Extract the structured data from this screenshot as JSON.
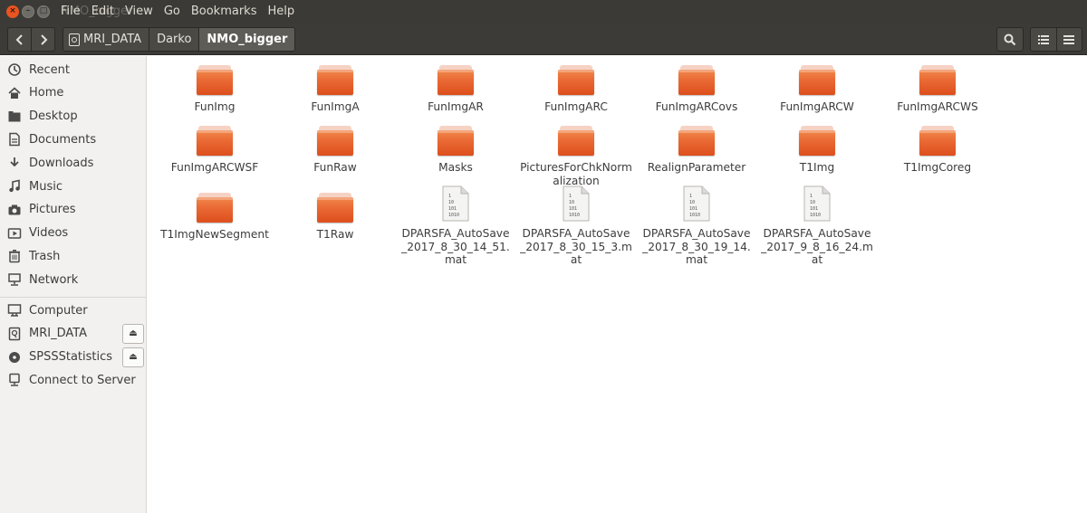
{
  "window": {
    "title_ghost": "NMO_bigger",
    "close_glyph": "×",
    "min_glyph": "–",
    "max_glyph": "□"
  },
  "menu": [
    "File",
    "Edit",
    "View",
    "Go",
    "Bookmarks",
    "Help"
  ],
  "toolbar": {
    "back_icon": "chevron-left-icon",
    "forward_icon": "chevron-right-icon",
    "breadcrumbs": [
      "MRI_DATA",
      "Darko",
      "NMO_bigger"
    ],
    "active_crumb": "NMO_bigger",
    "search_icon": "search-icon",
    "list_view_icon": "list-view-icon",
    "menu_icon": "hamburger-menu-icon"
  },
  "sidebar": {
    "places": [
      {
        "label": "Recent",
        "icon": "clock-icon"
      },
      {
        "label": "Home",
        "icon": "home-icon"
      },
      {
        "label": "Desktop",
        "icon": "desktop-folder-icon"
      },
      {
        "label": "Documents",
        "icon": "document-icon"
      },
      {
        "label": "Downloads",
        "icon": "download-icon"
      },
      {
        "label": "Music",
        "icon": "music-icon"
      },
      {
        "label": "Pictures",
        "icon": "camera-icon"
      },
      {
        "label": "Videos",
        "icon": "video-icon"
      },
      {
        "label": "Trash",
        "icon": "trash-icon"
      },
      {
        "label": "Network",
        "icon": "network-icon"
      }
    ],
    "devices": [
      {
        "label": "Computer",
        "icon": "computer-icon"
      },
      {
        "label": "MRI_DATA",
        "icon": "drive-icon",
        "eject": true
      },
      {
        "label": "SPSSStatistics",
        "icon": "disc-icon",
        "eject": true
      },
      {
        "label": "Connect to Server",
        "icon": "server-icon"
      }
    ],
    "eject_glyph": "⏏"
  },
  "files": [
    {
      "name": "FunImg",
      "type": "folder"
    },
    {
      "name": "FunImgA",
      "type": "folder"
    },
    {
      "name": "FunImgAR",
      "type": "folder"
    },
    {
      "name": "FunImgARC",
      "type": "folder"
    },
    {
      "name": "FunImgARCovs",
      "type": "folder"
    },
    {
      "name": "FunImgARCW",
      "type": "folder"
    },
    {
      "name": "FunImgARCWS",
      "type": "folder"
    },
    {
      "name": "FunImgARCWSF",
      "type": "folder"
    },
    {
      "name": "FunRaw",
      "type": "folder"
    },
    {
      "name": "Masks",
      "type": "folder"
    },
    {
      "name": "PicturesForChkNormalization",
      "type": "folder"
    },
    {
      "name": "RealignParameter",
      "type": "folder"
    },
    {
      "name": "T1Img",
      "type": "folder"
    },
    {
      "name": "T1ImgCoreg",
      "type": "folder"
    },
    {
      "name": "T1ImgNewSegment",
      "type": "folder"
    },
    {
      "name": "T1Raw",
      "type": "folder"
    },
    {
      "name": "DPARSFA_AutoSave_2017_8_30_14_51.mat",
      "type": "binary"
    },
    {
      "name": "DPARSFA_AutoSave_2017_8_30_15_3.mat",
      "type": "binary"
    },
    {
      "name": "DPARSFA_AutoSave_2017_8_30_19_14.mat",
      "type": "binary"
    },
    {
      "name": "DPARSFA_AutoSave_2017_9_8_16_24.mat",
      "type": "binary"
    }
  ],
  "binary_glyph_lines": [
    "1",
    "10",
    "101",
    "1010"
  ]
}
